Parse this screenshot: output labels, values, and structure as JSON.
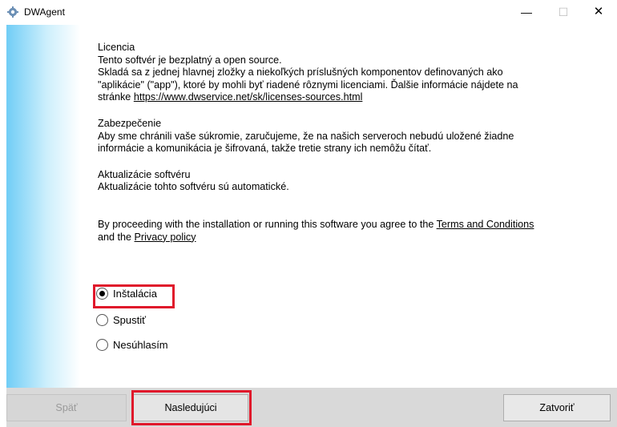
{
  "window": {
    "title": "DWAgent",
    "icon": "gear-icon",
    "controls": {
      "minimize": "—",
      "maximize": "☐",
      "close": "✕"
    }
  },
  "content": {
    "license_heading": "Licencia",
    "license_line1": "Tento softvér je bezplatný a open source.",
    "license_line2": "Skladá sa z jednej hlavnej zložky a niekoľkých príslušných komponentov definovaných ako",
    "license_line3": "\"aplikácie\" (\"app\"), ktoré by mohli byť riadené rôznymi licenciami. Ďalšie informácie nájdete na",
    "license_line4_prefix": "stránke ",
    "license_link": "https://www.dwservice.net/sk/licenses-sources.html",
    "security_heading": "Zabezpečenie",
    "security_line1": "Aby sme chránili vaše súkromie, zaručujeme, že na našich serveroch nebudú uložené žiadne",
    "security_line2": "informácie a komunikácia je šifrovaná, takže tretie strany ich nemôžu čítať.",
    "update_heading": "Aktualizácie softvéru",
    "update_line": "Aktualizácie tohto softvéru sú automatické.",
    "agree_prefix": "By proceeding with the installation or running this software you agree to the ",
    "terms_link": "Terms and Conditions",
    "agree_middle": "and the ",
    "privacy_link": "Privacy policy"
  },
  "options": {
    "selected": "install",
    "install_label": "Inštalácia",
    "run_label": "Spustiť",
    "decline_label": "Nesúhlasím"
  },
  "buttons": {
    "back": "Späť",
    "next": "Nasledujúci",
    "close": "Zatvoriť"
  },
  "colors": {
    "highlight": "#e0182b",
    "strip_start": "#70cdf6"
  }
}
